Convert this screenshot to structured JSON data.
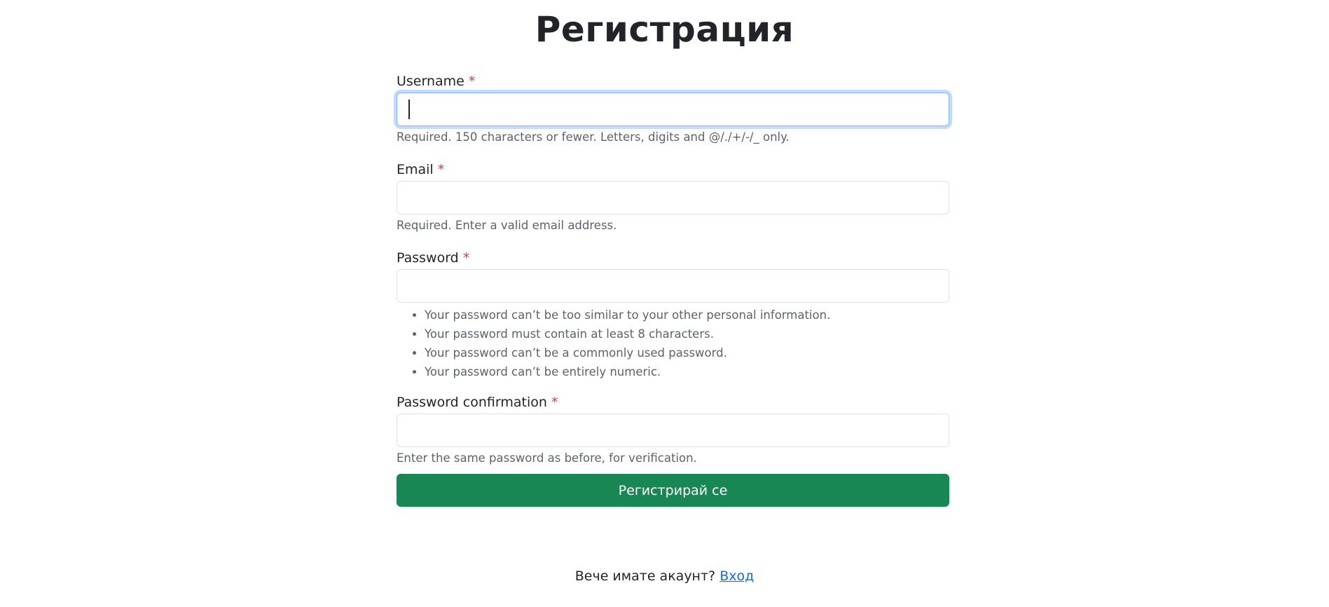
{
  "page": {
    "title": "Регистрация"
  },
  "form": {
    "username": {
      "label": "Username",
      "required_mark": "*",
      "value": "",
      "placeholder": "",
      "help": "Required. 150 characters or fewer. Letters, digits and @/./+/-/_ only."
    },
    "email": {
      "label": "Email",
      "required_mark": "*",
      "value": "",
      "placeholder": "",
      "help": "Required. Enter a valid email address."
    },
    "password": {
      "label": "Password",
      "required_mark": "*",
      "value": "",
      "placeholder": "",
      "help_items": [
        "Your password can’t be too similar to your other personal information.",
        "Your password must contain at least 8 characters.",
        "Your password can’t be a commonly used password.",
        "Your password can’t be entirely numeric."
      ]
    },
    "password_confirmation": {
      "label": "Password confirmation",
      "required_mark": "*",
      "value": "",
      "placeholder": "",
      "help": "Enter the same password as before, for verification."
    },
    "submit_label": "Регистрирай се"
  },
  "footer": {
    "prompt": "Вече имате акаунт?",
    "login_link": "Вход"
  },
  "colors": {
    "primary_button": "#198754",
    "link": "#0d6efd",
    "required": "#dc3545",
    "focus_border": "#86b7fe"
  }
}
